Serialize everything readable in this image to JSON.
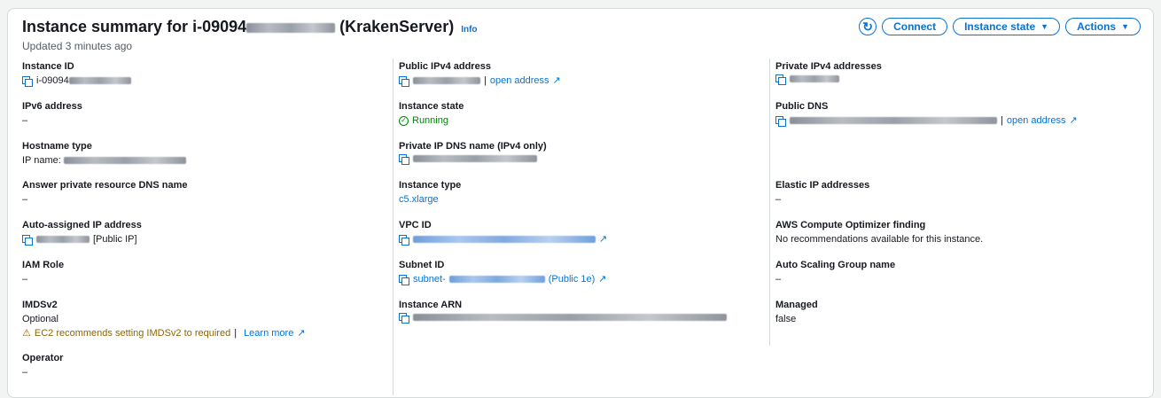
{
  "header": {
    "title_prefix": "Instance summary for i-09094",
    "title_suffix": " (KrakenServer)",
    "info": "Info",
    "updated": "Updated 3 minutes ago",
    "connect": "Connect",
    "instance_state": "Instance state",
    "actions": "Actions"
  },
  "col1": {
    "instance_id": {
      "label": "Instance ID",
      "value": "i-09094"
    },
    "ipv6": {
      "label": "IPv6 address",
      "value": "–"
    },
    "hostname": {
      "label": "Hostname type",
      "value": "IP name: "
    },
    "answer_dns": {
      "label": "Answer private resource DNS name",
      "value": "–"
    },
    "auto_ip": {
      "label": "Auto-assigned IP address",
      "value": "[Public IP]"
    },
    "iam": {
      "label": "IAM Role",
      "value": "–"
    },
    "imds": {
      "label": "IMDSv2",
      "value": "Optional",
      "warning": "EC2 recommends setting IMDSv2 to required",
      "learn_more": "Learn more"
    },
    "operator": {
      "label": "Operator",
      "value": "–"
    }
  },
  "col2": {
    "public_ipv4": {
      "label": "Public IPv4 address",
      "open": "open address"
    },
    "state": {
      "label": "Instance state",
      "value": "Running"
    },
    "private_dns": {
      "label": "Private IP DNS name (IPv4 only)"
    },
    "type": {
      "label": "Instance type",
      "value": "c5.xlarge"
    },
    "vpc": {
      "label": "VPC ID"
    },
    "subnet": {
      "label": "Subnet ID",
      "prefix": "subnet-",
      "suffix": "(Public 1e)"
    },
    "arn": {
      "label": "Instance ARN"
    }
  },
  "col3": {
    "private_ipv4": {
      "label": "Private IPv4 addresses"
    },
    "public_dns": {
      "label": "Public DNS",
      "open": "open address"
    },
    "elastic": {
      "label": "Elastic IP addresses",
      "value": "–"
    },
    "optimizer": {
      "label": "AWS Compute Optimizer finding",
      "value": "No recommendations available for this instance."
    },
    "asg": {
      "label": "Auto Scaling Group name",
      "value": "–"
    },
    "managed": {
      "label": "Managed",
      "value": "false"
    }
  },
  "colors": {
    "accent": "#0972d3",
    "success": "#037f0c",
    "warning": "#8d6605"
  }
}
